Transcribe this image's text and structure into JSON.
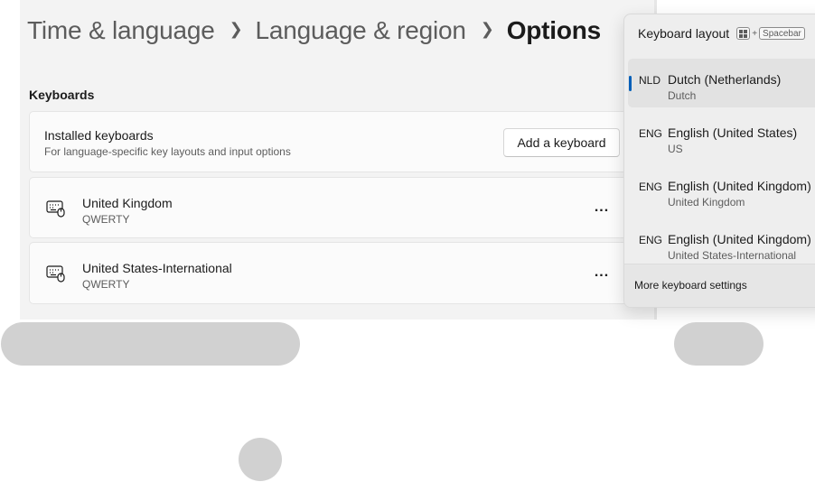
{
  "breadcrumb": {
    "items": [
      "Time & language",
      "Language & region"
    ],
    "current": "Options"
  },
  "keyboards_section": {
    "label": "Keyboards",
    "installed": {
      "title": "Installed keyboards",
      "subtitle": "For language-specific key layouts and input options",
      "add_label": "Add a keyboard"
    },
    "keyboards": [
      {
        "name": "United Kingdom",
        "layout": "QWERTY",
        "more": "..."
      },
      {
        "name": "United States-International",
        "layout": "QWERTY",
        "more": "..."
      }
    ]
  },
  "flyout": {
    "title": "Keyboard layout",
    "shortcut": {
      "plus": "+",
      "key": "Spacebar"
    },
    "items": [
      {
        "code": "NLD",
        "name": "Dutch (Netherlands)",
        "layout": "Dutch",
        "selected": true
      },
      {
        "code": "ENG",
        "name": "English (United States)",
        "layout": "US",
        "selected": false
      },
      {
        "code": "ENG",
        "name": "English (United Kingdom)",
        "layout": "United Kingdom",
        "selected": false
      },
      {
        "code": "ENG",
        "name": "English (United Kingdom)",
        "layout": "United States-International",
        "selected": false
      }
    ],
    "footer": "More keyboard settings"
  },
  "colors": {
    "accent": "#005fb8",
    "pane_bg": "#f3f3f3",
    "placeholder": "#d1d1d1"
  }
}
